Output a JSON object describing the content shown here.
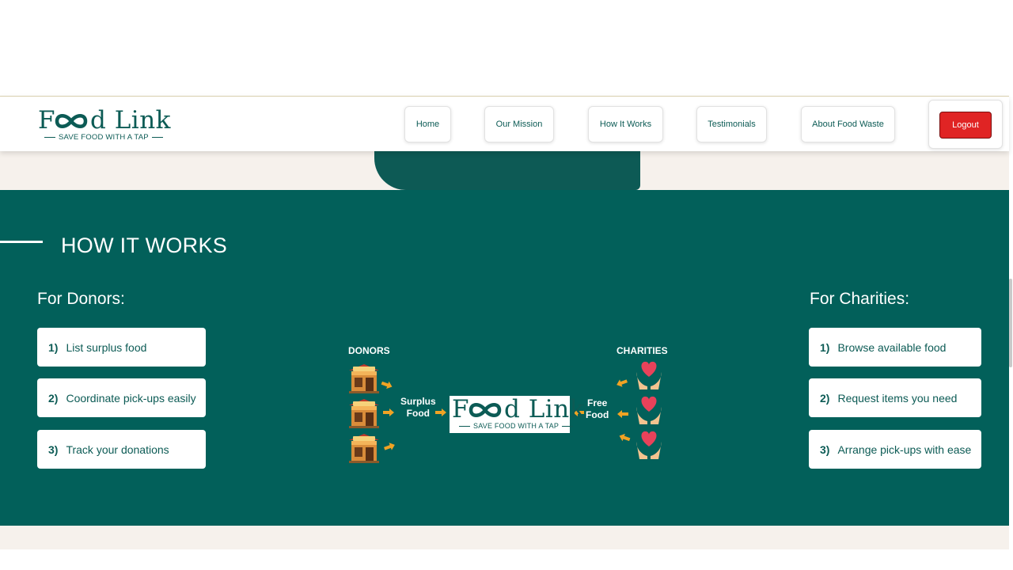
{
  "brand": {
    "name": "Food Link",
    "tagline": "SAVE FOOD WITH A TAP",
    "color": "#0c5b55"
  },
  "nav": {
    "items": [
      {
        "label": "Home"
      },
      {
        "label": "Our Mission"
      },
      {
        "label": "How It Works"
      },
      {
        "label": "Testimonials"
      },
      {
        "label": "About Food Waste"
      }
    ],
    "logout": "Logout"
  },
  "how_it_works": {
    "title": "HOW IT WORKS",
    "donors": {
      "title": "For Donors:",
      "steps": [
        {
          "num": "1)",
          "text": "List surplus food"
        },
        {
          "num": "2)",
          "text": "Coordinate pick-ups easily"
        },
        {
          "num": "3)",
          "text": "Track your donations"
        }
      ]
    },
    "charities": {
      "title": "For Charities:",
      "steps": [
        {
          "num": "1)",
          "text": "Browse available food"
        },
        {
          "num": "2)",
          "text": "Request items you need"
        },
        {
          "num": "3)",
          "text": "Arrange pick-ups with ease"
        }
      ]
    },
    "diagram": {
      "donors_label": "DONORS",
      "charities_label": "CHARITIES",
      "surplus_line1": "Surplus",
      "surplus_line2": "Food",
      "free_line1": "Free",
      "free_line2": "Food",
      "bakery_sign": "BAKERY"
    }
  },
  "colors": {
    "section_bg": "#02605a",
    "logout_bg": "#e02424",
    "arrow": "#f0a324",
    "heart": "#e8425a"
  }
}
